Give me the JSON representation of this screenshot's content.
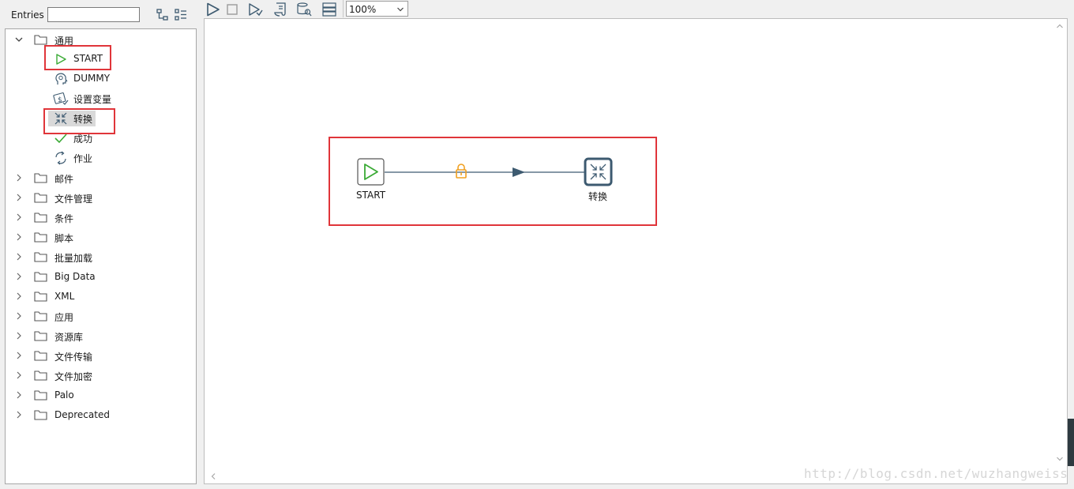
{
  "sidebar": {
    "entries_label": "Entries",
    "search_value": "",
    "general_folder": {
      "label": "通用",
      "children": [
        {
          "label": "START",
          "icon": "start-play-icon"
        },
        {
          "label": "DUMMY",
          "icon": "dummy-head-icon"
        },
        {
          "label": "设置变量",
          "icon": "set-variables-icon"
        },
        {
          "label": "转换",
          "icon": "transformation-icon"
        },
        {
          "label": "成功",
          "icon": "success-check-icon"
        },
        {
          "label": "作业",
          "icon": "job-cycle-icon"
        }
      ]
    },
    "folders": [
      {
        "label": "邮件"
      },
      {
        "label": "文件管理"
      },
      {
        "label": "条件"
      },
      {
        "label": "脚本"
      },
      {
        "label": "批量加载"
      },
      {
        "label": "Big Data"
      },
      {
        "label": "XML"
      },
      {
        "label": "应用"
      },
      {
        "label": "资源库"
      },
      {
        "label": "文件传输"
      },
      {
        "label": "文件加密"
      },
      {
        "label": "Palo"
      },
      {
        "label": "Deprecated"
      }
    ]
  },
  "toolbar": {
    "zoom_value": "100%"
  },
  "canvas": {
    "steps": [
      {
        "label": "START"
      },
      {
        "label": "转换"
      }
    ]
  },
  "watermark": "http://blog.csdn.net/wuzhangweiss",
  "colors": {
    "accent_green": "#3aaa35",
    "step_border": "#3d5a70",
    "hop_line": "#3d5a70",
    "lock_orange": "#f0a020",
    "highlight_red": "#e0353a"
  }
}
